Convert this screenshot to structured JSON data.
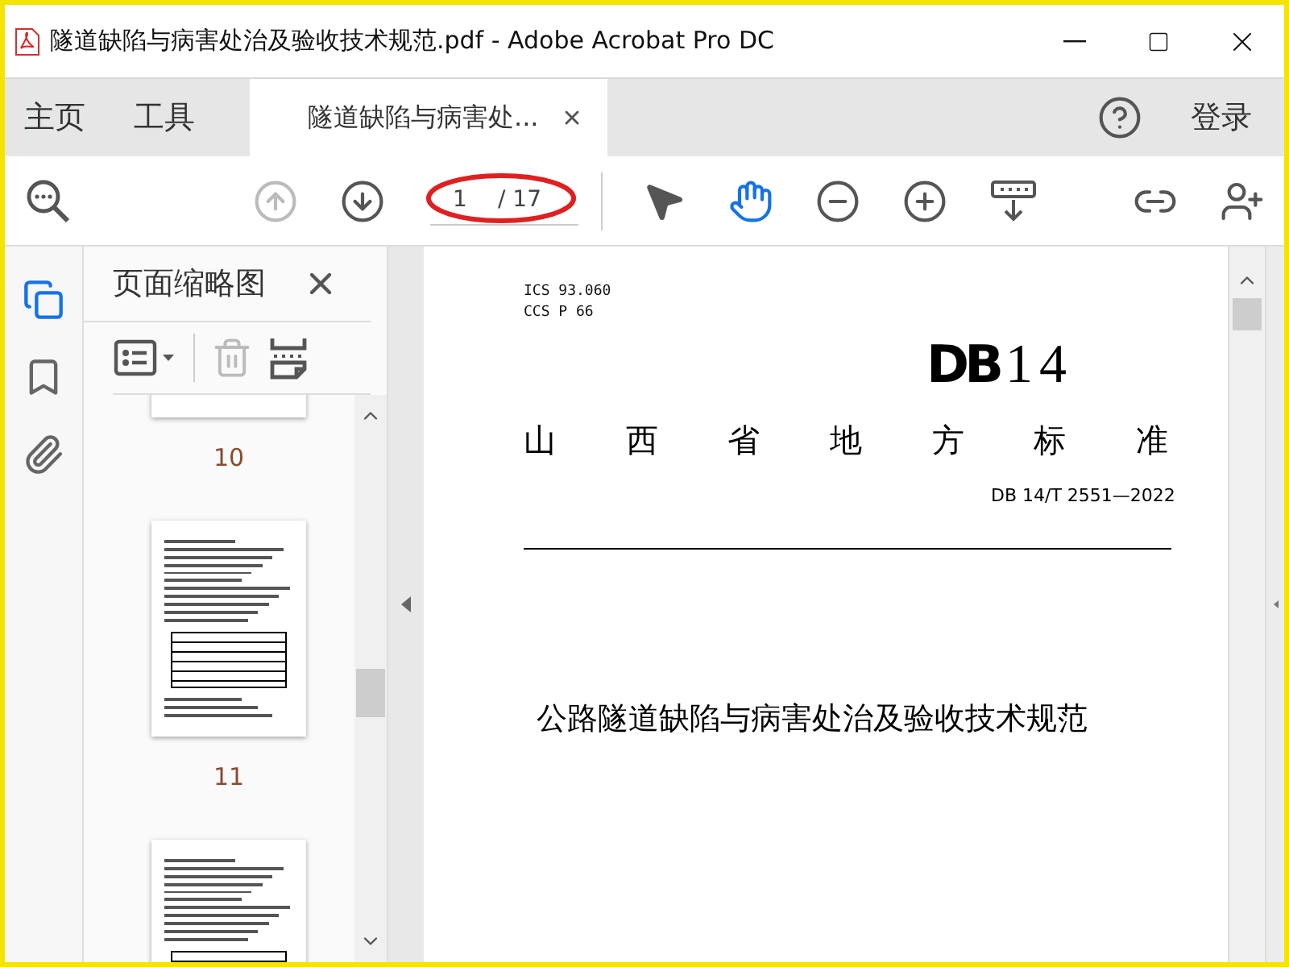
{
  "window": {
    "title": "隧道缺陷与病害处治及验收技术规范.pdf - Adobe Acrobat Pro DC"
  },
  "tabs": [
    {
      "label": "主页",
      "selected": false
    },
    {
      "label": "工具",
      "selected": false
    },
    {
      "label": "隧道缺陷与病害处...",
      "selected": true
    }
  ],
  "account": {
    "login": "登录"
  },
  "toolbar": {
    "previous": {
      "disabled": true
    },
    "next": {
      "disabled": false
    },
    "page_field": {
      "value": "1",
      "total": "/ 17",
      "circled": true
    },
    "tools": [
      {
        "kind": "select",
        "selected": false
      },
      {
        "kind": "hand",
        "selected": true
      }
    ]
  },
  "rail": [
    {
      "kind": "pages",
      "selected": true
    },
    {
      "kind": "bookmarks",
      "selected": false
    },
    {
      "kind": "attachments",
      "selected": false
    }
  ],
  "thumbnail_panel": {
    "title": "页面缩略图",
    "delete_disabled": true,
    "pages": [
      {
        "label": "10",
        "kind": "cut"
      },
      {
        "label": "11",
        "kind": "table"
      },
      {
        "kind": "table"
      }
    ]
  },
  "document": {
    "ics": "ICS  93.060",
    "ccs": "CCS  P 66",
    "logo_prefix": "DB",
    "logo_number": "14",
    "category": "山西省地方标准",
    "code": "DB 14/T  2551—2022",
    "title": "公路隧道缺陷与病害处治及验收技术规范"
  }
}
